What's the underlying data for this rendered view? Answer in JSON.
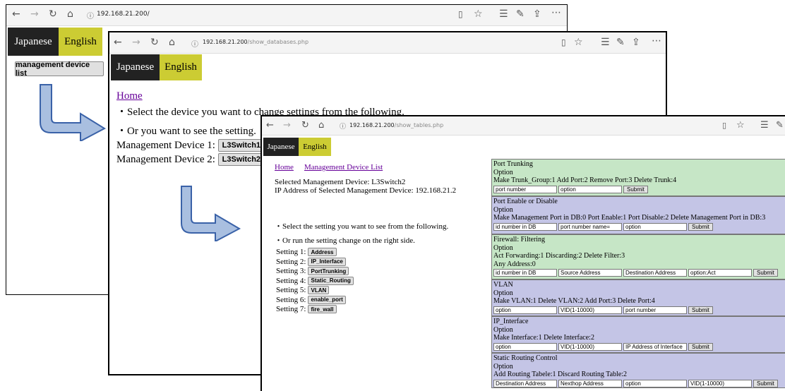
{
  "window1": {
    "url": "192.168.21.200/",
    "lang": {
      "japanese": "Japanese",
      "english": "English"
    },
    "button": "management device list"
  },
  "window2": {
    "url_host": "192.168.21.200",
    "url_path": "/show_databases.php",
    "lang": {
      "japanese": "Japanese",
      "english": "English"
    },
    "home": "Home",
    "line1": "・Select the device you want to change settings from the following.",
    "line2": "・Or you want to see the setting.",
    "devices": [
      {
        "label": "Management Device 1:",
        "button": "L3Switch1\""
      },
      {
        "label": "Management Device 2:",
        "button": "L3Switch2\""
      }
    ]
  },
  "window3": {
    "url_host": "192.168.21.200",
    "url_path": "/show_tables.php",
    "lang": {
      "japanese": "Japanese",
      "english": "English"
    },
    "home": "Home",
    "device_list": "Management Device List",
    "selected": "Selected Management Device: L3Switch2",
    "ip": "IP Address of Selected Management Device: 192.168.21.2",
    "line1": "・Select the setting you want to see from the following.",
    "line2": "・Or run the setting change on the right side.",
    "settings": [
      {
        "label": "Setting 1:",
        "button": "Address"
      },
      {
        "label": "Setting 2:",
        "button": "IP_Interface"
      },
      {
        "label": "Setting 3:",
        "button": "PortTrunking"
      },
      {
        "label": "Setting 4:",
        "button": "Static_Routing"
      },
      {
        "label": "Setting 5:",
        "button": "VLAN"
      },
      {
        "label": "Setting 6:",
        "button": "enable_port"
      },
      {
        "label": "Setting 7:",
        "button": "fire_wall"
      }
    ],
    "panels": [
      {
        "color": "#c6e6c6",
        "lines": [
          "Port Trunking",
          "Option",
          "Make Trunk_Group:1 Add Port:2 Remove Port:3 Delete Trunk:4"
        ],
        "inputs": [
          "port number",
          "option"
        ],
        "submit": "Submit"
      },
      {
        "color": "#c4c5e6",
        "lines": [
          "Port Enable or Disable",
          "Option",
          "Make Management Port in DB:0 Port Enable:1   Port Disable:2 Delete Management Port in DB:3"
        ],
        "inputs": [
          "id number in DB",
          "port number name=",
          "option"
        ],
        "submit": "Submit"
      },
      {
        "color": "#c6e6c6",
        "lines": [
          "Firewall: Filtering",
          "Option",
          "Act Forwarding:1 Discarding:2 Delete Filter:3",
          "Any Address:0"
        ],
        "inputs": [
          "id number in DB",
          "Source Address",
          "Destination Address",
          "option:Act"
        ],
        "submit": "Submit"
      },
      {
        "color": "#c4c5e6",
        "lines": [
          "VLAN",
          "Option",
          "Make VLAN:1 Delete VLAN:2 Add Port:3 Delete Port:4"
        ],
        "inputs": [
          "option",
          "VID(1-10000)",
          "port number"
        ],
        "submit": "Submit"
      },
      {
        "color": "#c4c5e6",
        "lines": [
          "IP_Interface",
          "Option",
          "Make Interface:1 Delete Interface:2"
        ],
        "inputs": [
          "option",
          "VID(1-10000)",
          "IP Address of Interface"
        ],
        "submit": "Submit"
      },
      {
        "color": "#c4c5e6",
        "lines": [
          "Static Routing Control",
          "Option",
          "Add Routing Tabele:1 Discard Routing Table:2"
        ],
        "inputs": [
          "Destination Address",
          "Nexthop Address",
          "option",
          "VID(1-10000)"
        ],
        "submit": "Submit"
      }
    ]
  },
  "icons": [
    "back-icon",
    "forward-icon",
    "refresh-icon",
    "home-icon",
    "info-icon",
    "reading-view-icon",
    "favorite-star-icon",
    "favorites-list-icon",
    "pen-icon",
    "share-icon",
    "more-icon"
  ],
  "colors": {
    "arrow": "#a9bfe0",
    "arrow_stroke": "#3a62a8",
    "english_bg": "#cccc33",
    "japanese_bg": "#222222",
    "link": "#660099"
  }
}
